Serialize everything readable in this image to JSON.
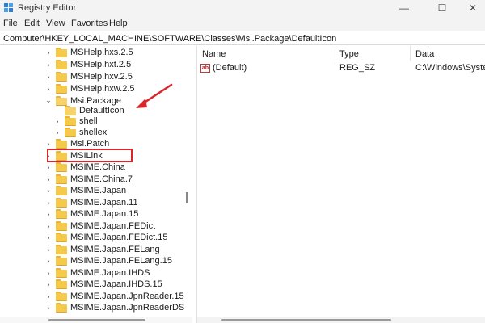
{
  "window": {
    "title": "Registry Editor",
    "minimize_glyph": "—",
    "maximize_glyph": "☐",
    "close_glyph": "✕"
  },
  "menu": [
    "File",
    "Edit",
    "View",
    "Favorites",
    "Help"
  ],
  "address": "Computer\\HKEY_LOCAL_MACHINE\\SOFTWARE\\Classes\\Msi.Package\\DefaultIcon",
  "tree": {
    "items": [
      {
        "label": "MSHelp.hxs.2.5",
        "chevron": "›"
      },
      {
        "label": "MSHelp.hxt.2.5",
        "chevron": "›"
      },
      {
        "label": "MSHelp.hxv.2.5",
        "chevron": "›"
      },
      {
        "label": "MSHelp.hxw.2.5",
        "chevron": "›"
      },
      {
        "label": "Msi.Package",
        "chevron": "⌄"
      },
      {
        "label": "DefaultIcon",
        "chevron": ""
      },
      {
        "label": "shell",
        "chevron": "›"
      },
      {
        "label": "shellex",
        "chevron": "›"
      },
      {
        "label": "Msi.Patch",
        "chevron": "›"
      },
      {
        "label": "MSILink",
        "chevron": "›"
      },
      {
        "label": "MSIME.China",
        "chevron": "›"
      },
      {
        "label": "MSIME.China.7",
        "chevron": "›"
      },
      {
        "label": "MSIME.Japan",
        "chevron": "›"
      },
      {
        "label": "MSIME.Japan.11",
        "chevron": "›"
      },
      {
        "label": "MSIME.Japan.15",
        "chevron": "›"
      },
      {
        "label": "MSIME.Japan.FEDict",
        "chevron": "›"
      },
      {
        "label": "MSIME.Japan.FEDict.15",
        "chevron": "›"
      },
      {
        "label": "MSIME.Japan.FELang",
        "chevron": "›"
      },
      {
        "label": "MSIME.Japan.FELang.15",
        "chevron": "›"
      },
      {
        "label": "MSIME.Japan.IHDS",
        "chevron": "›"
      },
      {
        "label": "MSIME.Japan.IHDS.15",
        "chevron": "›"
      },
      {
        "label": "MSIME.Japan.JpnReader.15",
        "chevron": "›"
      },
      {
        "label": "MSIME.Japan.JpnReaderDS",
        "chevron": "›"
      }
    ],
    "selected": "DefaultIcon"
  },
  "list": {
    "columns": [
      "Name",
      "Type",
      "Data"
    ],
    "rows": [
      {
        "name": "(Default)",
        "type": "REG_SZ",
        "data": "C:\\Windows\\System",
        "icon": "ab-string-icon"
      }
    ]
  },
  "colors": {
    "highlight_box": "#d9262c",
    "arrow": "#d9262c",
    "folder": "#f5c94a"
  }
}
